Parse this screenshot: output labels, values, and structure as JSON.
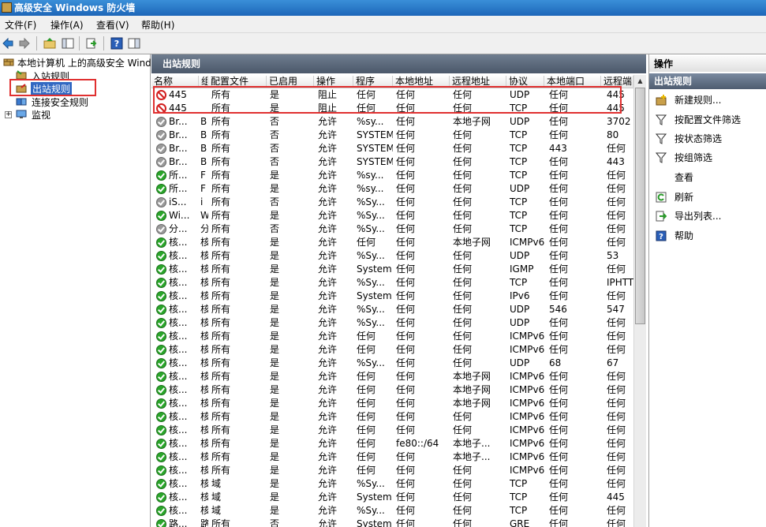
{
  "window": {
    "title": "高级安全 Windows 防火墙"
  },
  "menu": [
    "文件(F)",
    "操作(A)",
    "查看(V)",
    "帮助(H)"
  ],
  "tree": {
    "root": "本地计算机 上的高级安全 Windows",
    "items": [
      "入站规则",
      "出站规则",
      "连接安全规则",
      "监视"
    ],
    "expander": "+"
  },
  "center": {
    "header": "出站规则",
    "columns": [
      "名称",
      "组",
      "配置文件",
      "已启用",
      "操作",
      "程序",
      "本地地址",
      "远程地址",
      "协议",
      "本地端口",
      "远程端"
    ],
    "rows": [
      {
        "status": "block",
        "name": "445",
        "group": "",
        "profile": "所有",
        "enabled": "是",
        "action": "阻止",
        "program": "任何",
        "local": "任何",
        "remote": "任何",
        "protocol": "UDP",
        "lport": "任何",
        "rport": "445"
      },
      {
        "status": "block",
        "name": "445",
        "group": "",
        "profile": "所有",
        "enabled": "是",
        "action": "阻止",
        "program": "任何",
        "local": "任何",
        "remote": "任何",
        "protocol": "TCP",
        "lport": "任何",
        "rport": "445"
      },
      {
        "status": "off",
        "name": "Br...",
        "group": "B",
        "profile": "所有",
        "enabled": "否",
        "action": "允许",
        "program": "%sy...",
        "local": "任何",
        "remote": "本地子网",
        "protocol": "UDP",
        "lport": "任何",
        "rport": "3702"
      },
      {
        "status": "off",
        "name": "Br...",
        "group": "B",
        "profile": "所有",
        "enabled": "否",
        "action": "允许",
        "program": "SYSTEM",
        "local": "任何",
        "remote": "任何",
        "protocol": "TCP",
        "lport": "任何",
        "rport": "80"
      },
      {
        "status": "off",
        "name": "Br...",
        "group": "B",
        "profile": "所有",
        "enabled": "否",
        "action": "允许",
        "program": "SYSTEM",
        "local": "任何",
        "remote": "任何",
        "protocol": "TCP",
        "lport": "443",
        "rport": "任何"
      },
      {
        "status": "off",
        "name": "Br...",
        "group": "B",
        "profile": "所有",
        "enabled": "否",
        "action": "允许",
        "program": "SYSTEM",
        "local": "任何",
        "remote": "任何",
        "protocol": "TCP",
        "lport": "任何",
        "rport": "443"
      },
      {
        "status": "on",
        "name": "所...",
        "group": "F",
        "profile": "所有",
        "enabled": "是",
        "action": "允许",
        "program": "%sy...",
        "local": "任何",
        "remote": "任何",
        "protocol": "TCP",
        "lport": "任何",
        "rport": "任何"
      },
      {
        "status": "on",
        "name": "所...",
        "group": "F",
        "profile": "所有",
        "enabled": "是",
        "action": "允许",
        "program": "%sy...",
        "local": "任何",
        "remote": "任何",
        "protocol": "UDP",
        "lport": "任何",
        "rport": "任何"
      },
      {
        "status": "off",
        "name": "iS...",
        "group": "i",
        "profile": "所有",
        "enabled": "否",
        "action": "允许",
        "program": "%Sy...",
        "local": "任何",
        "remote": "任何",
        "protocol": "TCP",
        "lport": "任何",
        "rport": "任何"
      },
      {
        "status": "on",
        "name": "Wi...",
        "group": "W",
        "profile": "所有",
        "enabled": "是",
        "action": "允许",
        "program": "%Sy...",
        "local": "任何",
        "remote": "任何",
        "protocol": "TCP",
        "lport": "任何",
        "rport": "任何"
      },
      {
        "status": "off",
        "name": "分...",
        "group": "分",
        "profile": "所有",
        "enabled": "否",
        "action": "允许",
        "program": "%Sy...",
        "local": "任何",
        "remote": "任何",
        "protocol": "TCP",
        "lport": "任何",
        "rport": "任何"
      },
      {
        "status": "on",
        "name": "核...",
        "group": "核",
        "profile": "所有",
        "enabled": "是",
        "action": "允许",
        "program": "任何",
        "local": "任何",
        "remote": "本地子网",
        "protocol": "ICMPv6",
        "lport": "任何",
        "rport": "任何"
      },
      {
        "status": "on",
        "name": "核...",
        "group": "核",
        "profile": "所有",
        "enabled": "是",
        "action": "允许",
        "program": "%Sy...",
        "local": "任何",
        "remote": "任何",
        "protocol": "UDP",
        "lport": "任何",
        "rport": "53"
      },
      {
        "status": "on",
        "name": "核...",
        "group": "核",
        "profile": "所有",
        "enabled": "是",
        "action": "允许",
        "program": "System",
        "local": "任何",
        "remote": "任何",
        "protocol": "IGMP",
        "lport": "任何",
        "rport": "任何"
      },
      {
        "status": "on",
        "name": "核...",
        "group": "核",
        "profile": "所有",
        "enabled": "是",
        "action": "允许",
        "program": "%Sy...",
        "local": "任何",
        "remote": "任何",
        "protocol": "TCP",
        "lport": "任何",
        "rport": "IPHTTI"
      },
      {
        "status": "on",
        "name": "核...",
        "group": "核",
        "profile": "所有",
        "enabled": "是",
        "action": "允许",
        "program": "System",
        "local": "任何",
        "remote": "任何",
        "protocol": "IPv6",
        "lport": "任何",
        "rport": "任何"
      },
      {
        "status": "on",
        "name": "核...",
        "group": "核",
        "profile": "所有",
        "enabled": "是",
        "action": "允许",
        "program": "%Sy...",
        "local": "任何",
        "remote": "任何",
        "protocol": "UDP",
        "lport": "546",
        "rport": "547"
      },
      {
        "status": "on",
        "name": "核...",
        "group": "核",
        "profile": "所有",
        "enabled": "是",
        "action": "允许",
        "program": "%Sy...",
        "local": "任何",
        "remote": "任何",
        "protocol": "UDP",
        "lport": "任何",
        "rport": "任何"
      },
      {
        "status": "on",
        "name": "核...",
        "group": "核",
        "profile": "所有",
        "enabled": "是",
        "action": "允许",
        "program": "任何",
        "local": "任何",
        "remote": "任何",
        "protocol": "ICMPv6",
        "lport": "任何",
        "rport": "任何"
      },
      {
        "status": "on",
        "name": "核...",
        "group": "核",
        "profile": "所有",
        "enabled": "是",
        "action": "允许",
        "program": "任何",
        "local": "任何",
        "remote": "任何",
        "protocol": "ICMPv6",
        "lport": "任何",
        "rport": "任何"
      },
      {
        "status": "on",
        "name": "核...",
        "group": "核",
        "profile": "所有",
        "enabled": "是",
        "action": "允许",
        "program": "%Sy...",
        "local": "任何",
        "remote": "任何",
        "protocol": "UDP",
        "lport": "68",
        "rport": "67"
      },
      {
        "status": "on",
        "name": "核...",
        "group": "核",
        "profile": "所有",
        "enabled": "是",
        "action": "允许",
        "program": "任何",
        "local": "任何",
        "remote": "本地子网",
        "protocol": "ICMPv6",
        "lport": "任何",
        "rport": "任何"
      },
      {
        "status": "on",
        "name": "核...",
        "group": "核",
        "profile": "所有",
        "enabled": "是",
        "action": "允许",
        "program": "任何",
        "local": "任何",
        "remote": "本地子网",
        "protocol": "ICMPv6",
        "lport": "任何",
        "rport": "任何"
      },
      {
        "status": "on",
        "name": "核...",
        "group": "核",
        "profile": "所有",
        "enabled": "是",
        "action": "允许",
        "program": "任何",
        "local": "任何",
        "remote": "本地子网",
        "protocol": "ICMPv6",
        "lport": "任何",
        "rport": "任何"
      },
      {
        "status": "on",
        "name": "核...",
        "group": "核",
        "profile": "所有",
        "enabled": "是",
        "action": "允许",
        "program": "任何",
        "local": "任何",
        "remote": "任何",
        "protocol": "ICMPv6",
        "lport": "任何",
        "rport": "任何"
      },
      {
        "status": "on",
        "name": "核...",
        "group": "核",
        "profile": "所有",
        "enabled": "是",
        "action": "允许",
        "program": "任何",
        "local": "任何",
        "remote": "任何",
        "protocol": "ICMPv6",
        "lport": "任何",
        "rport": "任何"
      },
      {
        "status": "on",
        "name": "核...",
        "group": "核",
        "profile": "所有",
        "enabled": "是",
        "action": "允许",
        "program": "任何",
        "local": "fe80::/64",
        "remote": "本地子...",
        "protocol": "ICMPv6",
        "lport": "任何",
        "rport": "任何"
      },
      {
        "status": "on",
        "name": "核...",
        "group": "核",
        "profile": "所有",
        "enabled": "是",
        "action": "允许",
        "program": "任何",
        "local": "任何",
        "remote": "本地子...",
        "protocol": "ICMPv6",
        "lport": "任何",
        "rport": "任何"
      },
      {
        "status": "on",
        "name": "核...",
        "group": "核",
        "profile": "所有",
        "enabled": "是",
        "action": "允许",
        "program": "任何",
        "local": "任何",
        "remote": "任何",
        "protocol": "ICMPv6",
        "lport": "任何",
        "rport": "任何"
      },
      {
        "status": "on",
        "name": "核...",
        "group": "核",
        "profile": "域",
        "enabled": "是",
        "action": "允许",
        "program": "%Sy...",
        "local": "任何",
        "remote": "任何",
        "protocol": "TCP",
        "lport": "任何",
        "rport": "任何"
      },
      {
        "status": "on",
        "name": "核...",
        "group": "核",
        "profile": "域",
        "enabled": "是",
        "action": "允许",
        "program": "System",
        "local": "任何",
        "remote": "任何",
        "protocol": "TCP",
        "lport": "任何",
        "rport": "445"
      },
      {
        "status": "on",
        "name": "核...",
        "group": "核",
        "profile": "域",
        "enabled": "是",
        "action": "允许",
        "program": "%Sy...",
        "local": "任何",
        "remote": "任何",
        "protocol": "TCP",
        "lport": "任何",
        "rport": "任何"
      },
      {
        "status": "on",
        "name": "路...",
        "group": "路",
        "profile": "所有",
        "enabled": "否",
        "action": "允许",
        "program": "System",
        "local": "任何",
        "remote": "任何",
        "protocol": "GRE",
        "lport": "任何",
        "rport": "任何"
      }
    ]
  },
  "actions": {
    "title": "操作",
    "section": "出站规则",
    "items": [
      "新建规则...",
      "按配置文件筛选",
      "按状态筛选",
      "按组筛选",
      "查看",
      "刷新",
      "导出列表...",
      "帮助"
    ]
  }
}
